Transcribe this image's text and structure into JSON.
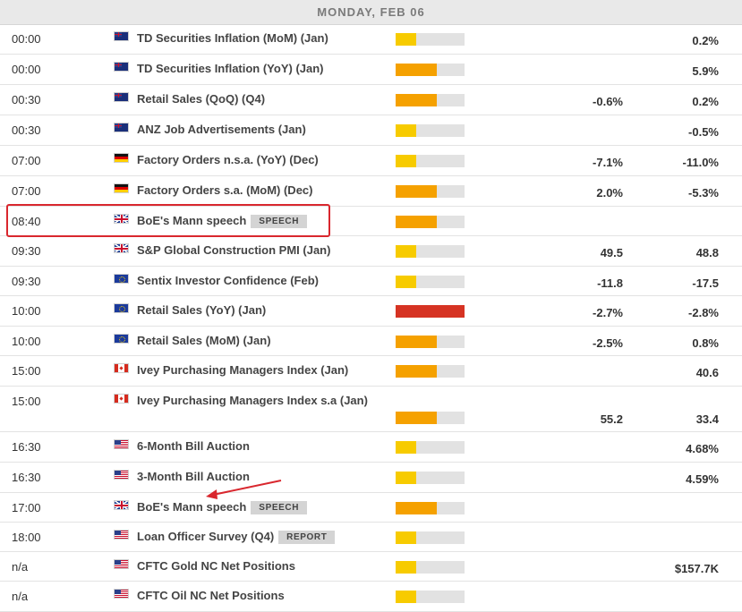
{
  "day_header": "MONDAY, FEB 06",
  "colors": {
    "low": "#f7cb00",
    "medium": "#f5a100",
    "high": "#d63323",
    "track": "#e2e2e2",
    "highlight": "#d9272e"
  },
  "events": [
    {
      "time": "00:00",
      "flag": "au",
      "name": "TD Securities Inflation (MoM) (Jan)",
      "impact": "low",
      "actual": "",
      "previous": "0.2%"
    },
    {
      "time": "00:00",
      "flag": "au",
      "name": "TD Securities Inflation (YoY) (Jan)",
      "impact": "medium",
      "actual": "",
      "previous": "5.9%"
    },
    {
      "time": "00:30",
      "flag": "au",
      "name": "Retail Sales (QoQ) (Q4)",
      "impact": "medium",
      "actual": "-0.6%",
      "previous": "0.2%"
    },
    {
      "time": "00:30",
      "flag": "au",
      "name": "ANZ Job Advertisements (Jan)",
      "impact": "low",
      "actual": "",
      "previous": "-0.5%"
    },
    {
      "time": "07:00",
      "flag": "de",
      "name": "Factory Orders n.s.a. (YoY) (Dec)",
      "impact": "low",
      "actual": "-7.1%",
      "previous": "-11.0%"
    },
    {
      "time": "07:00",
      "flag": "de",
      "name": "Factory Orders s.a. (MoM) (Dec)",
      "impact": "medium",
      "actual": "2.0%",
      "previous": "-5.3%"
    },
    {
      "time": "08:40",
      "flag": "gb",
      "name": "BoE's Mann speech",
      "tag": "SPEECH",
      "impact": "medium",
      "actual": "",
      "previous": ""
    },
    {
      "time": "09:30",
      "flag": "gb",
      "name": "S&P Global Construction PMI (Jan)",
      "impact": "low",
      "actual": "49.5",
      "previous": "48.8"
    },
    {
      "time": "09:30",
      "flag": "eu",
      "name": "Sentix Investor Confidence (Feb)",
      "impact": "low",
      "actual": "-11.8",
      "previous": "-17.5"
    },
    {
      "time": "10:00",
      "flag": "eu",
      "name": "Retail Sales (YoY) (Jan)",
      "impact": "high",
      "actual": "-2.7%",
      "previous": "-2.8%"
    },
    {
      "time": "10:00",
      "flag": "eu",
      "name": "Retail Sales (MoM) (Jan)",
      "impact": "medium",
      "actual": "-2.5%",
      "previous": "0.8%"
    },
    {
      "time": "15:00",
      "flag": "ca",
      "name": "Ivey Purchasing Managers Index (Jan)",
      "impact": "medium",
      "actual": "",
      "previous": "40.6"
    },
    {
      "time": "15:00",
      "flag": "ca",
      "name": "Ivey Purchasing Managers Index s.a (Jan)",
      "impact": "medium",
      "actual": "55.2",
      "previous": "33.4"
    },
    {
      "time": "16:30",
      "flag": "us",
      "name": "6-Month Bill Auction",
      "impact": "low",
      "actual": "",
      "previous": "4.68%"
    },
    {
      "time": "16:30",
      "flag": "us",
      "name": "3-Month Bill Auction",
      "impact": "low",
      "actual": "",
      "previous": "4.59%"
    },
    {
      "time": "17:00",
      "flag": "gb",
      "name": "BoE's Mann speech",
      "tag": "SPEECH",
      "impact": "medium",
      "actual": "",
      "previous": ""
    },
    {
      "time": "18:00",
      "flag": "us",
      "name": "Loan Officer Survey (Q4)",
      "tag": "REPORT",
      "impact": "low",
      "actual": "",
      "previous": ""
    },
    {
      "time": "n/a",
      "flag": "us",
      "name": "CFTC Gold NC Net Positions",
      "impact": "low",
      "actual": "",
      "previous": "$157.7K"
    },
    {
      "time": "n/a",
      "flag": "us",
      "name": "CFTC Oil NC Net Positions",
      "impact": "low",
      "actual": "",
      "previous": ""
    }
  ]
}
